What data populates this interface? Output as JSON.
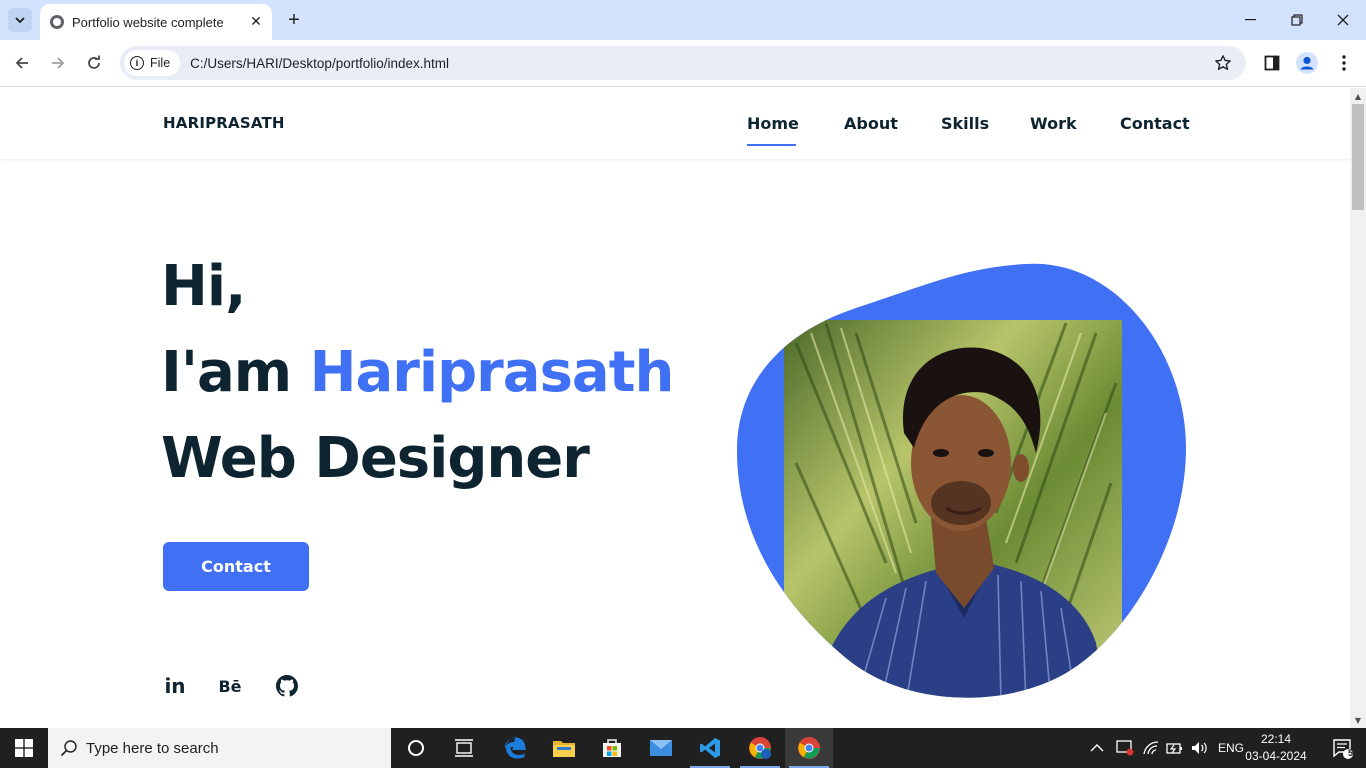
{
  "browser": {
    "tab_title": "Portfolio website complete",
    "close_glyph": "✕",
    "new_tab_glyph": "+",
    "chip_label": "File",
    "url": "C:/Users/HARI/Desktop/portfolio/index.html"
  },
  "site": {
    "logo": "HARIPRASATH",
    "nav": [
      "Home",
      "About",
      "Skills",
      "Work",
      "Contact"
    ],
    "active_nav": "Home",
    "hero": {
      "line1": "Hi,",
      "line2_prefix": "I'am ",
      "line2_name": "Hariprasath",
      "line3": "Web Designer"
    },
    "contact_button": "Contact",
    "social": [
      "linkedin-icon",
      "behance-icon",
      "github-icon"
    ],
    "social_text": {
      "linkedin": "in",
      "behance": "Bē"
    }
  },
  "taskbar": {
    "search_placeholder": "Type here to search",
    "language": "ENG",
    "time": "22:14",
    "date": "03-04-2024",
    "notification_count": "5"
  },
  "colors": {
    "accent": "#4070f4",
    "text_dark": "#0e2431",
    "tabbar": "#d3e3fd"
  }
}
